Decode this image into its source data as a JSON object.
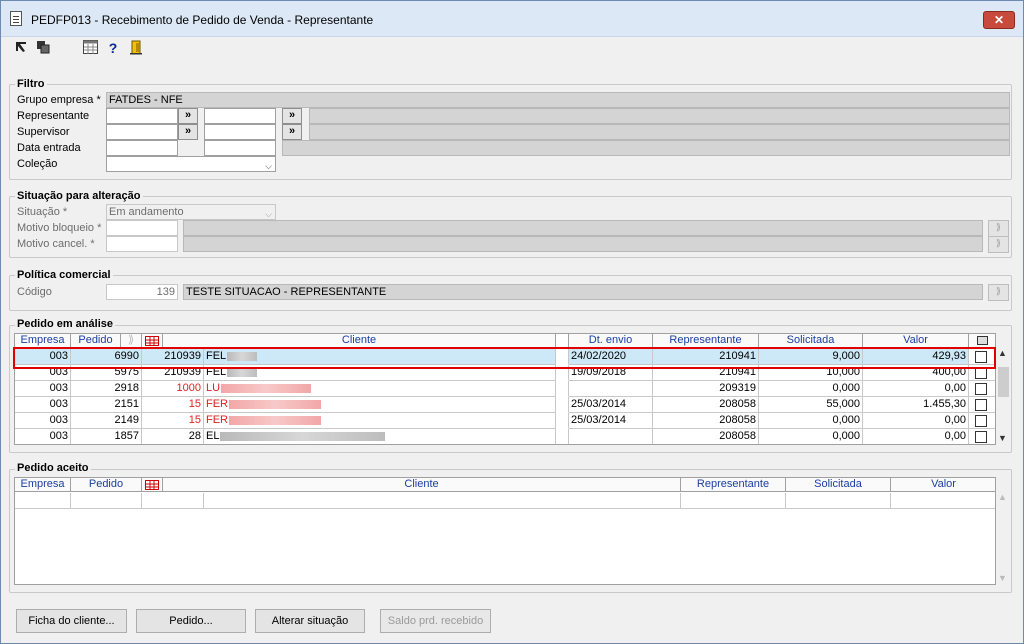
{
  "window": {
    "title": "PEDFP013 - Recebimento de Pedido de Venda - Representante",
    "close_label": "✕"
  },
  "toolbar": {
    "icons": [
      "cursor-icon",
      "copy-icon",
      "calendar-grid-icon",
      "help-icon",
      "exit-icon"
    ]
  },
  "filtro": {
    "legend": "Filtro",
    "grupo_empresa_label": "Grupo empresa *",
    "grupo_empresa_value": "FATDES - NFE",
    "representante_label": "Representante",
    "supervisor_label": "Supervisor",
    "data_entrada_label": "Data entrada",
    "colecao_label": "Coleção",
    "lookup_label": "»"
  },
  "situacao": {
    "legend": "Situação para alteração",
    "situacao_label": "Situação *",
    "situacao_value": "Em andamento",
    "motivo_bloqueio_label": "Motivo bloqueio *",
    "motivo_cancel_label": "Motivo cancel. *"
  },
  "politica": {
    "legend": "Política comercial",
    "codigo_label": "Código",
    "codigo_value": "139",
    "descricao_value": "TESTE SITUACAO - REPRESENTANTE"
  },
  "pedido_analise": {
    "legend": "Pedido em análise",
    "headers": {
      "empresa": "Empresa",
      "pedido": "Pedido",
      "cliente": "Cliente",
      "dt_envio": "Dt. envio",
      "representante": "Representante",
      "solicitada": "Solicitada",
      "valor": "Valor"
    },
    "rows": [
      {
        "empresa": "003",
        "pedido": "6990",
        "cod": "210939",
        "cliente": "FEL",
        "dt_envio": "24/02/2020",
        "representante": "210941",
        "solicitada": "9,000",
        "valor": "429,93"
      },
      {
        "empresa": "003",
        "pedido": "5975",
        "cod": "210939",
        "cliente": "FEL",
        "dt_envio": "19/09/2018",
        "representante": "210941",
        "solicitada": "10,000",
        "valor": "400,00"
      },
      {
        "empresa": "003",
        "pedido": "2918",
        "cod": "1000",
        "cliente": "LU",
        "dt_envio": "",
        "representante": "209319",
        "solicitada": "0,000",
        "valor": "0,00"
      },
      {
        "empresa": "003",
        "pedido": "2151",
        "cod": "15",
        "cliente": "FER",
        "dt_envio": "25/03/2014",
        "representante": "208058",
        "solicitada": "55,000",
        "valor": "1.455,30"
      },
      {
        "empresa": "003",
        "pedido": "2149",
        "cod": "15",
        "cliente": "FER",
        "dt_envio": "25/03/2014",
        "representante": "208058",
        "solicitada": "0,000",
        "valor": "0,00"
      },
      {
        "empresa": "003",
        "pedido": "1857",
        "cod": "28",
        "cliente": "EL",
        "dt_envio": "",
        "representante": "208058",
        "solicitada": "0,000",
        "valor": "0,00"
      }
    ]
  },
  "pedido_aceito": {
    "legend": "Pedido aceito",
    "headers": {
      "empresa": "Empresa",
      "pedido": "Pedido",
      "cliente": "Cliente",
      "representante": "Representante",
      "solicitada": "Solicitada",
      "valor": "Valor"
    }
  },
  "buttons": {
    "ficha": "Ficha do cliente...",
    "pedido": "Pedido...",
    "alterar": "Alterar situação",
    "saldo": "Saldo prd. recebido"
  }
}
